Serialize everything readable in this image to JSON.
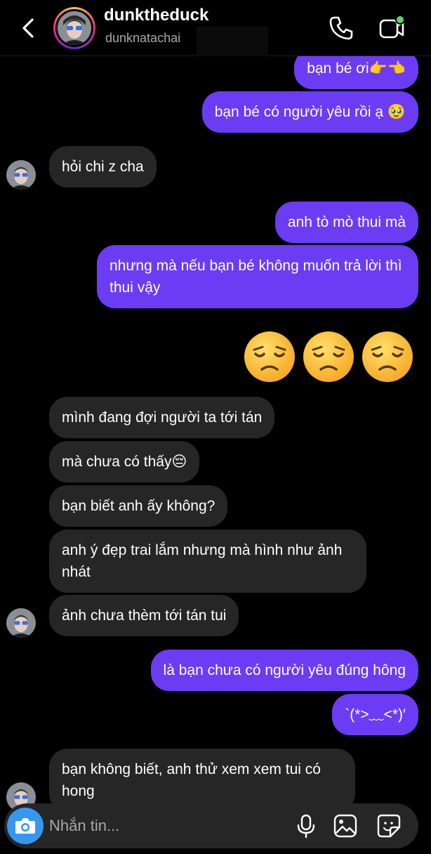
{
  "header": {
    "display_name": "dunktheduck",
    "username": "dunknatachai"
  },
  "messages": [
    {
      "id": "m1",
      "side": "out",
      "text": "bạn bé ơi👉👈"
    },
    {
      "id": "m2",
      "side": "out",
      "text": "bạn bé có người yêu rồi ạ 🥹"
    },
    {
      "id": "m3",
      "side": "in",
      "text": "hỏi chi z cha"
    },
    {
      "id": "m4",
      "side": "out",
      "text": "anh tò mò thui mà"
    },
    {
      "id": "m5",
      "side": "out",
      "text": "nhưng mà nếu bạn bé không muốn trả lời thì thui vậy"
    },
    {
      "id": "m6",
      "side": "out",
      "text": "😞😞😞",
      "emoji_only": true
    },
    {
      "id": "m7",
      "side": "in",
      "text": "mình đang đợi người ta tới tán"
    },
    {
      "id": "m8",
      "side": "in",
      "text": "mà chưa có thấy😔"
    },
    {
      "id": "m9",
      "side": "in",
      "text": "bạn biết anh ấy không?"
    },
    {
      "id": "m10",
      "side": "in",
      "text": "anh ý đẹp trai lắm nhưng mà hình như ảnh nhát"
    },
    {
      "id": "m11",
      "side": "in",
      "text": "ảnh chưa thèm tới tán tui"
    },
    {
      "id": "m12",
      "side": "out",
      "text": "là bạn chưa có người yêu đúng hông"
    },
    {
      "id": "m13",
      "side": "out",
      "text": "`(*>﹏<*)′"
    },
    {
      "id": "m14",
      "side": "in",
      "text": "bạn không biết, anh thử xem xem tui có hong"
    }
  ],
  "composer": {
    "placeholder": "Nhắn tin..."
  },
  "icons": {
    "back": "chevron-left-icon",
    "call": "phone-icon",
    "video": "video-call-icon",
    "camera": "camera-icon",
    "mic": "microphone-icon",
    "gallery": "image-icon",
    "sticker": "sticker-icon"
  },
  "colors": {
    "background": "#000000",
    "outgoing_bubble": "#6b3cf4",
    "incoming_bubble": "#262626",
    "camera_button": "#3797f0",
    "active_dot": "#5bd46b",
    "muted_text": "#a8a8a8"
  }
}
